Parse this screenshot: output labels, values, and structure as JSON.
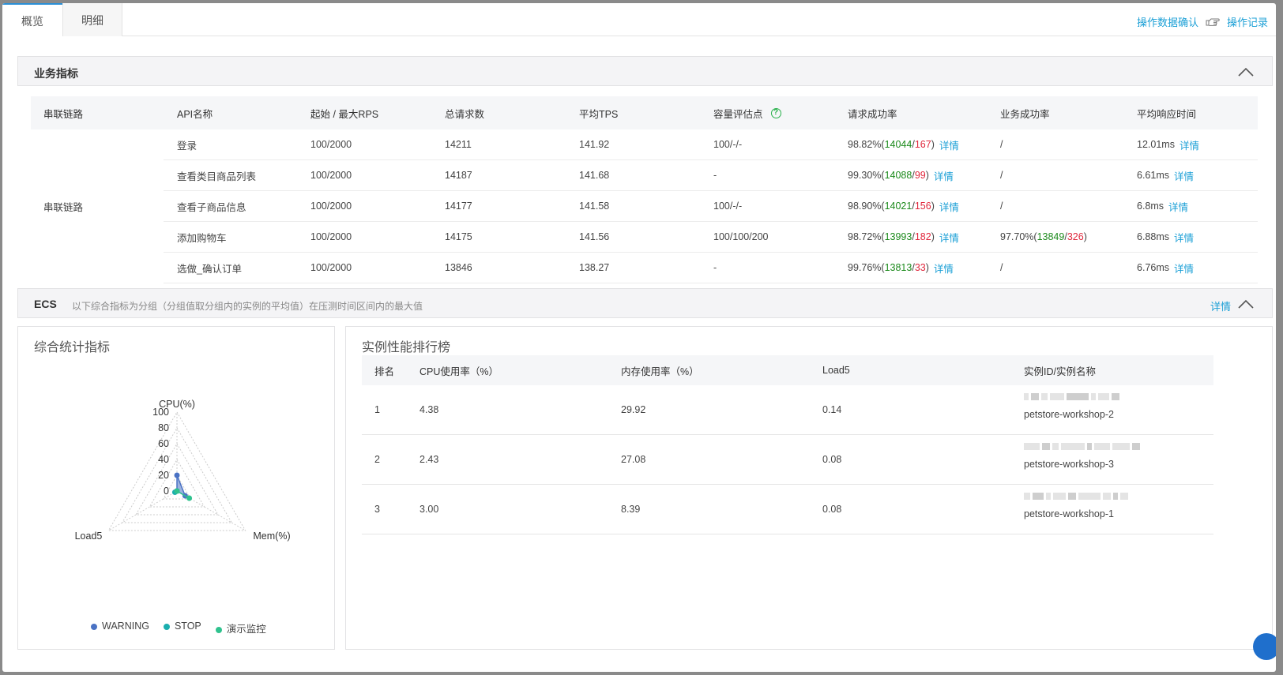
{
  "tabs": [
    {
      "label": "概览",
      "active": true
    },
    {
      "label": "明细",
      "active": false
    }
  ],
  "top_actions": {
    "confirm": "操作数据确认",
    "record": "操作记录",
    "icon": "pointing-hand-icon"
  },
  "biz_section": {
    "title": "业务指标"
  },
  "biz_table": {
    "headers": [
      "串联链路",
      "API名称",
      "起始 / 最大RPS",
      "总请求数",
      "平均TPS",
      "容量评估点",
      "请求成功率",
      "业务成功率",
      "平均响应时间"
    ],
    "chain_name": "串联链路",
    "rows": [
      {
        "api": "登录",
        "rps": "100/2000",
        "total": "14211",
        "tps": "141.92",
        "capacity": "100/-/-",
        "req_rate": "98.82%",
        "req_ok": "14044",
        "req_fail": "167",
        "biz": "/",
        "biz_ok": "",
        "biz_fail": "",
        "resp": "12.01ms"
      },
      {
        "api": "查看类目商品列表",
        "rps": "100/2000",
        "total": "14187",
        "tps": "141.68",
        "capacity": "-",
        "req_rate": "99.30%",
        "req_ok": "14088",
        "req_fail": "99",
        "biz": "/",
        "biz_ok": "",
        "biz_fail": "",
        "resp": "6.61ms"
      },
      {
        "api": "查看子商品信息",
        "rps": "100/2000",
        "total": "14177",
        "tps": "141.58",
        "capacity": "100/-/-",
        "req_rate": "98.90%",
        "req_ok": "14021",
        "req_fail": "156",
        "biz": "/",
        "biz_ok": "",
        "biz_fail": "",
        "resp": "6.8ms"
      },
      {
        "api": "添加购物车",
        "rps": "100/2000",
        "total": "14175",
        "tps": "141.56",
        "capacity": "100/100/200",
        "req_rate": "98.72%",
        "req_ok": "13993",
        "req_fail": "182",
        "biz": "97.70%",
        "biz_ok": "13849",
        "biz_fail": "326",
        "resp": "6.88ms"
      },
      {
        "api": "选做_确认订单",
        "rps": "100/2000",
        "total": "13846",
        "tps": "138.27",
        "capacity": "-",
        "req_rate": "99.76%",
        "req_ok": "13813",
        "req_fail": "33",
        "biz": "/",
        "biz_ok": "",
        "biz_fail": "",
        "resp": "6.76ms"
      }
    ],
    "detail_label": "详情"
  },
  "ecs_section": {
    "title": "ECS",
    "subtitle": "以下综合指标为分组（分组值取分组内的实例的平均值）在压测时间区间内的最大值",
    "detail": "详情"
  },
  "radar_panel": {
    "title": "综合统计指标"
  },
  "chart_data": {
    "type": "radar",
    "indicators": [
      "CPU(%)",
      "Mem(%)",
      "Load5"
    ],
    "max": 100,
    "ticks": [
      0,
      20,
      40,
      60,
      80,
      100
    ],
    "series": [
      {
        "name": "WARNING",
        "color": "#4a72c4",
        "values": [
          20,
          12,
          0
        ]
      },
      {
        "name": "STOP",
        "color": "#1aaeae",
        "values": [
          0,
          0,
          3
        ]
      },
      {
        "name": "演示监控",
        "color": "#2fc28e",
        "values": [
          0,
          18,
          0
        ]
      }
    ]
  },
  "rank_panel": {
    "title": "实例性能排行榜",
    "headers": [
      "排名",
      "CPU使用率（%）",
      "内存使用率（%）",
      "Load5",
      "实例ID/实例名称"
    ],
    "rows": [
      {
        "rank": "1",
        "cpu": "4.38",
        "mem": "29.92",
        "load": "0.14",
        "name": "petstore-workshop-2"
      },
      {
        "rank": "2",
        "cpu": "2.43",
        "mem": "27.08",
        "load": "0.08",
        "name": "petstore-workshop-3"
      },
      {
        "rank": "3",
        "cpu": "3.00",
        "mem": "8.39",
        "load": "0.08",
        "name": "petstore-workshop-1"
      }
    ]
  }
}
